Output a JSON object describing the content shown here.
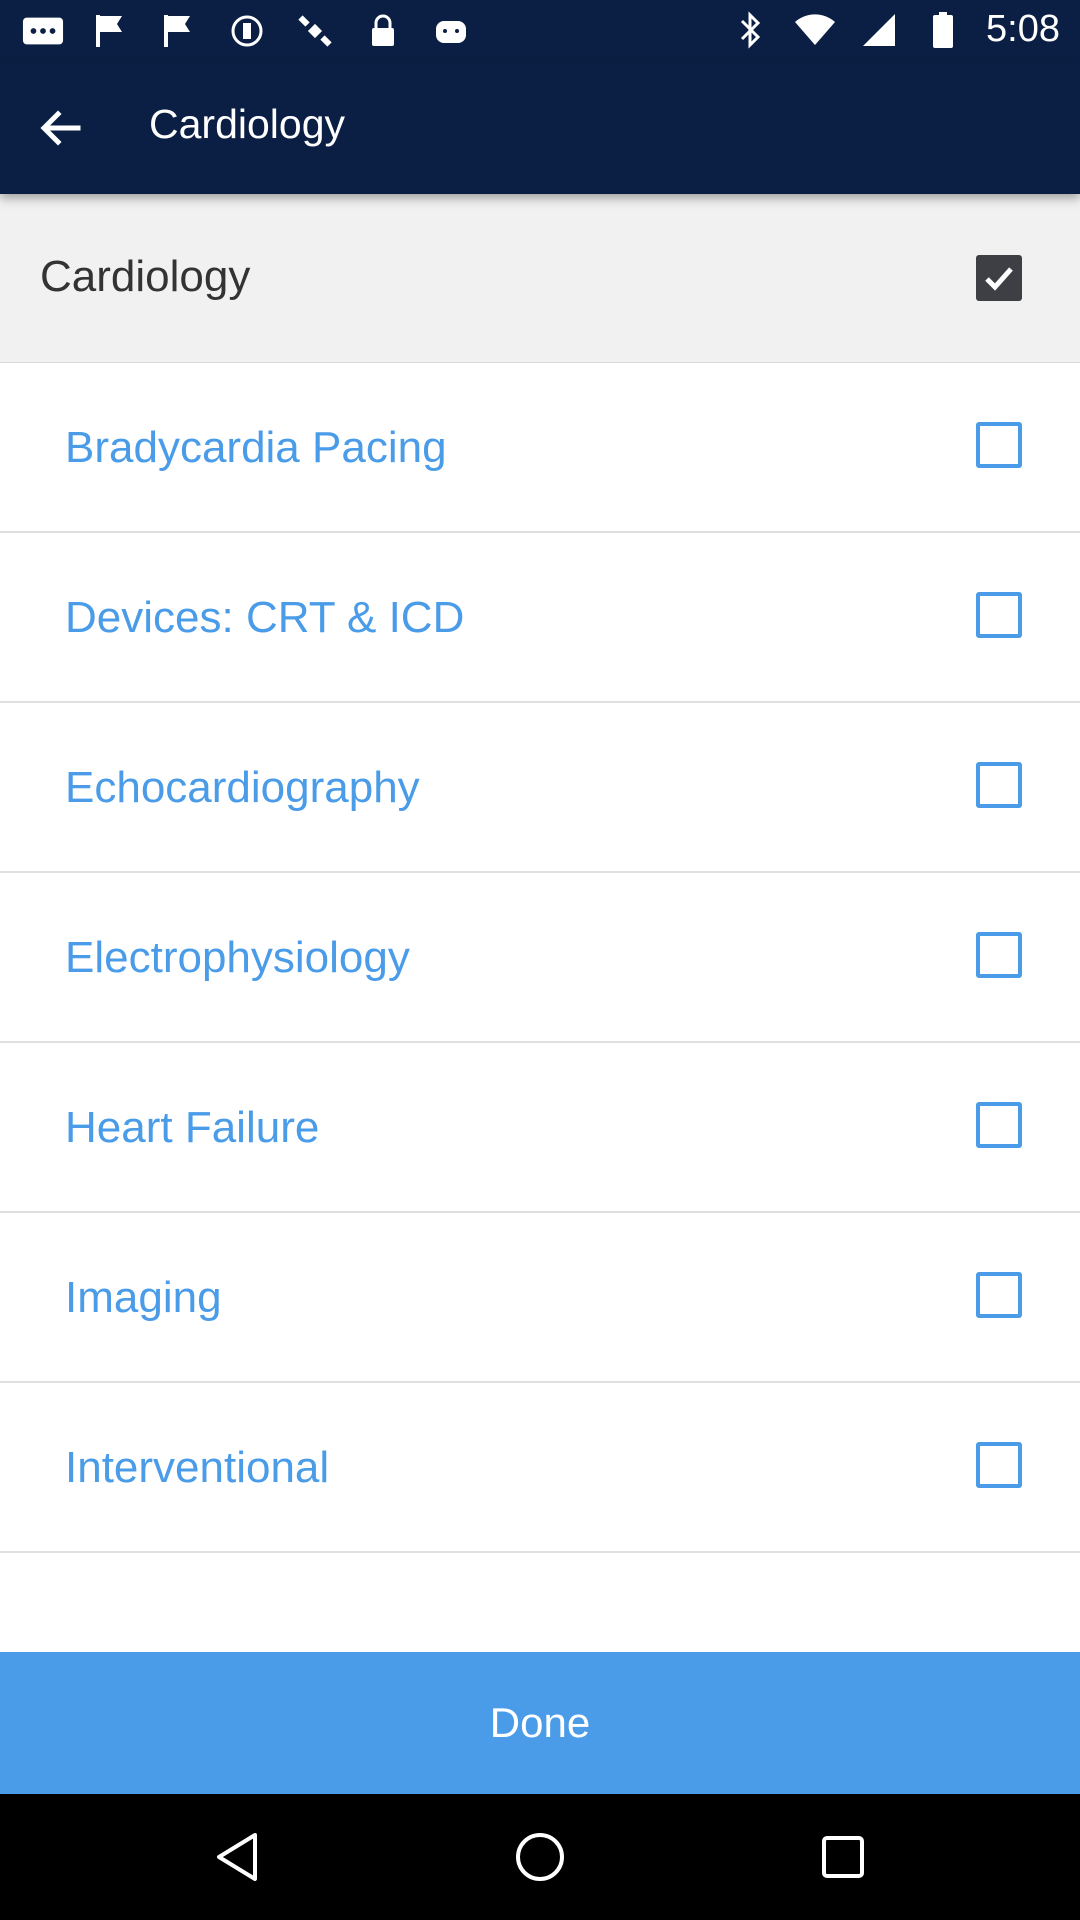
{
  "status_bar": {
    "time": "5:08",
    "left_icons": [
      "more-icon",
      "flag-icon",
      "flag-icon",
      "circle-icon",
      "satellite-icon",
      "lock-icon",
      "android-icon"
    ],
    "right_icons": [
      "bluetooth-icon",
      "wifi-icon",
      "signal-icon",
      "battery-icon"
    ]
  },
  "app_bar": {
    "title": "Cardiology",
    "back_icon": "arrow-back-icon"
  },
  "parent": {
    "label": "Cardiology",
    "checked": true
  },
  "items": [
    {
      "label": "Bradycardia Pacing",
      "checked": false
    },
    {
      "label": "Devices: CRT & ICD",
      "checked": false
    },
    {
      "label": "Echocardiography",
      "checked": false
    },
    {
      "label": "Electrophysiology",
      "checked": false
    },
    {
      "label": "Heart Failure",
      "checked": false
    },
    {
      "label": "Imaging",
      "checked": false
    },
    {
      "label": "Interventional",
      "checked": false
    }
  ],
  "done_button": {
    "label": "Done"
  },
  "nav_bar": {
    "icons": [
      "back-triangle-icon",
      "home-circle-icon",
      "recents-square-icon"
    ]
  },
  "colors": {
    "header": "#0b1f44",
    "accent": "#4a9ce8",
    "parent_background": "#f1f1f1"
  }
}
